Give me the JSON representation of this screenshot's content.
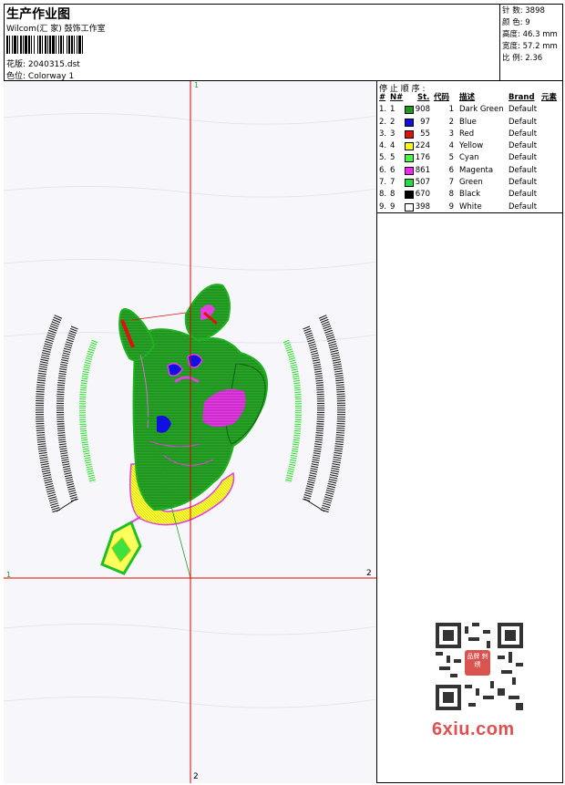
{
  "header": {
    "title": "生产作业图",
    "company": "Wilcom(汇 家) 鼓饰工作室",
    "design_label": "花版:",
    "design_value": "2040315.dst",
    "color_label": "色位:",
    "color_value": "Colorway 1"
  },
  "stats": {
    "stitches": "针 数: 3898",
    "colors": "颜 色: 9",
    "height": "高度: 46.3 mm",
    "width": "宽度: 57.2 mm",
    "scale": "比 例: 2.36"
  },
  "canvas": {
    "axis_top": "1",
    "axis_left": "1",
    "axis_right": "2",
    "axis_bottom": "2",
    "background": "#f7f7fb",
    "axis_color": "#e00000"
  },
  "panel": {
    "title": "停 止 顺 序 :",
    "headers": {
      "no": "#",
      "n": "N#",
      "st": "St.",
      "code": "代码",
      "desc": "描述",
      "brand": "Brand",
      "element": "元素"
    },
    "rows": [
      {
        "no": "1.",
        "n": "1",
        "swatch": "#1a9e1a",
        "st": "908",
        "code": "1",
        "desc": "Dark Green",
        "brand": "Default"
      },
      {
        "no": "2.",
        "n": "2",
        "swatch": "#1010e0",
        "st": "97",
        "code": "2",
        "desc": "Blue",
        "brand": "Default"
      },
      {
        "no": "3.",
        "n": "3",
        "swatch": "#e01010",
        "st": "55",
        "code": "3",
        "desc": "Red",
        "brand": "Default"
      },
      {
        "no": "4.",
        "n": "4",
        "swatch": "#ffff00",
        "st": "224",
        "code": "4",
        "desc": "Yellow",
        "brand": "Default"
      },
      {
        "no": "5.",
        "n": "5",
        "swatch": "#40ff40",
        "st": "176",
        "code": "5",
        "desc": "Cyan",
        "brand": "Default"
      },
      {
        "no": "6.",
        "n": "6",
        "swatch": "#ff20ff",
        "st": "861",
        "code": "6",
        "desc": "Magenta",
        "brand": "Default"
      },
      {
        "no": "7.",
        "n": "7",
        "swatch": "#20e040",
        "st": "507",
        "code": "7",
        "desc": "Green",
        "brand": "Default"
      },
      {
        "no": "8.",
        "n": "8",
        "swatch": "#000000",
        "st": "670",
        "code": "8",
        "desc": "Black",
        "brand": "Default"
      },
      {
        "no": "9.",
        "n": "9",
        "swatch": "#ffffff",
        "st": "398",
        "code": "9",
        "desc": "White",
        "brand": "Default"
      }
    ]
  },
  "watermark": {
    "text": "6xiu.com",
    "badge": "品牌 刺绣"
  }
}
